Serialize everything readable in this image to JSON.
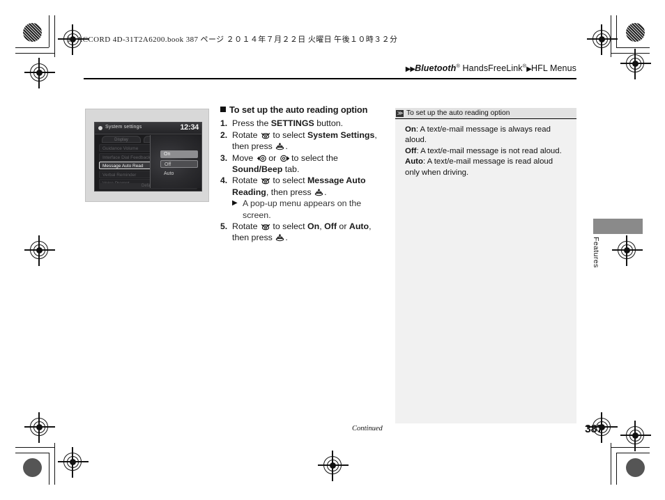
{
  "print_marks": {
    "file_line": "15 ACCORD 4D-31T2A6200.book  387 ページ  ２０１４年７月２２日  火曜日  午後１０時３２分"
  },
  "header": {
    "breadcrumb_arrow": "▶▶",
    "brand": "Bluetooth",
    "brand_reg": "®",
    "product": " HandsFreeLink",
    "product_reg": "®",
    "mid_arrow": "▶",
    "section": "HFL Menus"
  },
  "device_screenshot": {
    "title": "System settings",
    "clock": "12:34",
    "tabs": [
      "Display",
      "Sound/B"
    ],
    "list_items": [
      "Guidance Volume",
      "Interface Dial Feedback",
      "Message Auto Read",
      "Verbal Reminder",
      "Voice Prompt"
    ],
    "selected_item": "Message Auto Read",
    "footer": "Default",
    "popup_options": [
      "On",
      "Off",
      "Auto"
    ],
    "popup_selected": "On"
  },
  "instructions": {
    "heading": "To set up the auto reading option",
    "steps": [
      {
        "num": "1.",
        "parts": [
          {
            "t": "text",
            "v": "Press the "
          },
          {
            "t": "bold",
            "v": "SETTINGS"
          },
          {
            "t": "text",
            "v": " button."
          }
        ]
      },
      {
        "num": "2.",
        "parts": [
          {
            "t": "text",
            "v": "Rotate "
          },
          {
            "t": "icon",
            "v": "rotate-knob-icon"
          },
          {
            "t": "text",
            "v": " to select "
          },
          {
            "t": "bold",
            "v": "System Settings"
          },
          {
            "t": "text",
            "v": ", then press "
          },
          {
            "t": "icon",
            "v": "press-knob-icon"
          },
          {
            "t": "text",
            "v": "."
          }
        ]
      },
      {
        "num": "3.",
        "parts": [
          {
            "t": "text",
            "v": "Move "
          },
          {
            "t": "icon",
            "v": "knob-left-icon"
          },
          {
            "t": "text",
            "v": " or "
          },
          {
            "t": "icon",
            "v": "knob-right-icon"
          },
          {
            "t": "text",
            "v": " to select the "
          },
          {
            "t": "bold",
            "v": "Sound/Beep"
          },
          {
            "t": "text",
            "v": " tab."
          }
        ]
      },
      {
        "num": "4.",
        "parts": [
          {
            "t": "text",
            "v": "Rotate "
          },
          {
            "t": "icon",
            "v": "rotate-knob-icon"
          },
          {
            "t": "text",
            "v": " to select "
          },
          {
            "t": "bold",
            "v": "Message Auto Reading"
          },
          {
            "t": "text",
            "v": ", then press "
          },
          {
            "t": "icon",
            "v": "press-knob-icon"
          },
          {
            "t": "text",
            "v": "."
          }
        ]
      }
    ],
    "substep": {
      "arrow": "▶",
      "text": "A pop-up menu appears on the screen."
    },
    "step5": {
      "num": "5.",
      "parts": [
        {
          "t": "text",
          "v": "Rotate "
        },
        {
          "t": "icon",
          "v": "rotate-knob-icon"
        },
        {
          "t": "text",
          "v": " to select "
        },
        {
          "t": "bold",
          "v": "On"
        },
        {
          "t": "text",
          "v": ", "
        },
        {
          "t": "bold",
          "v": "Off"
        },
        {
          "t": "text",
          "v": " or "
        },
        {
          "t": "bold",
          "v": "Auto"
        },
        {
          "t": "text",
          "v": ", then press "
        },
        {
          "t": "icon",
          "v": "press-knob-icon"
        },
        {
          "t": "text",
          "v": "."
        }
      ]
    }
  },
  "note_panel": {
    "badge": "≫",
    "heading": "To set up the auto reading option",
    "lines": [
      {
        "term": "On",
        "desc": ": A text/e-mail message is always read aloud."
      },
      {
        "term": "Off",
        "desc": ": A text/e-mail message is not read aloud."
      },
      {
        "term": "Auto",
        "desc": ": A text/e-mail message is read aloud only when driving."
      }
    ]
  },
  "side_tab": {
    "label": "Features"
  },
  "footer": {
    "continued": "Continued",
    "page_number": "387"
  },
  "colors": {
    "note_panel_bg": "#f1f1f1",
    "note_head_bg": "#e2e2e2",
    "side_tab_bg": "#8a8a8a",
    "screenshot_frame": "#d8d8d8"
  }
}
